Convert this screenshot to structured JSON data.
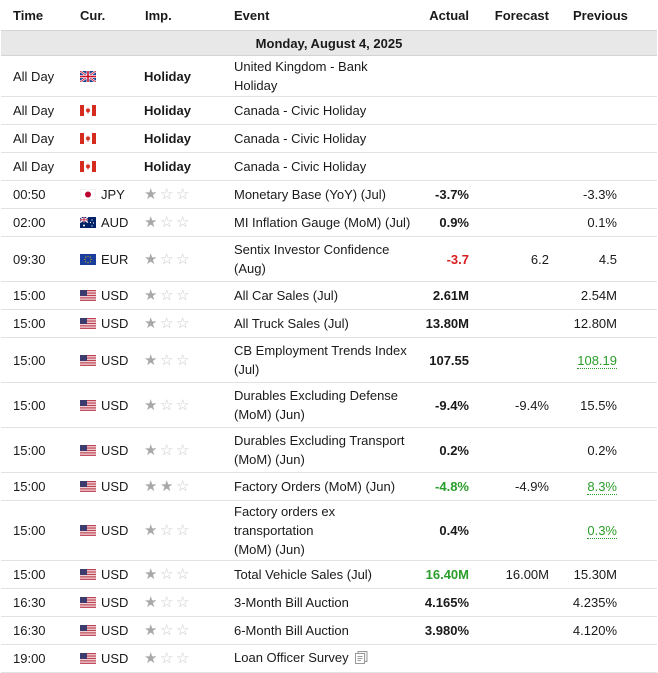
{
  "headers": {
    "time": "Time",
    "currency": "Cur.",
    "importance": "Imp.",
    "event": "Event",
    "actual": "Actual",
    "forecast": "Forecast",
    "previous": "Previous"
  },
  "date_label": "Monday, August 4, 2025",
  "colors": {
    "positive": "#2a9d2a",
    "negative": "#d91e1e",
    "star_full": "#a8a8a8",
    "star_empty": "#c9c9c9"
  },
  "rows": [
    {
      "time": "All Day",
      "flag": "uk-flag-icon",
      "currency": "",
      "holiday": "Holiday",
      "event": "United Kingdom - Bank Holiday",
      "actual": "",
      "forecast": "",
      "previous": ""
    },
    {
      "time": "All Day",
      "flag": "canada-flag-icon",
      "currency": "",
      "holiday": "Holiday",
      "event": "Canada - Civic Holiday",
      "actual": "",
      "forecast": "",
      "previous": ""
    },
    {
      "time": "All Day",
      "flag": "canada-flag-icon",
      "currency": "",
      "holiday": "Holiday",
      "event": "Canada - Civic Holiday",
      "actual": "",
      "forecast": "",
      "previous": ""
    },
    {
      "time": "All Day",
      "flag": "canada-flag-icon",
      "currency": "",
      "holiday": "Holiday",
      "event": "Canada - Civic Holiday",
      "actual": "",
      "forecast": "",
      "previous": ""
    },
    {
      "time": "00:50",
      "flag": "japan-flag-icon",
      "currency": "JPY",
      "stars": 1,
      "event": "Monetary Base (YoY) (Jul)",
      "actual": "-3.7%",
      "forecast": "",
      "previous": "-3.3%"
    },
    {
      "time": "02:00",
      "flag": "australia-flag-icon",
      "currency": "AUD",
      "stars": 1,
      "event": "MI Inflation Gauge (MoM) (Jul)",
      "actual": "0.9%",
      "forecast": "",
      "previous": "0.1%"
    },
    {
      "time": "09:30",
      "flag": "eu-flag-icon",
      "currency": "EUR",
      "stars": 1,
      "event_line1": "Sentix Investor Confidence",
      "event_line2": "(Aug)",
      "actual": "-3.7",
      "actual_color": "red",
      "forecast": "6.2",
      "previous": "4.5"
    },
    {
      "time": "15:00",
      "flag": "us-flag-icon",
      "currency": "USD",
      "stars": 1,
      "event": "All Car Sales (Jul)",
      "actual": "2.61M",
      "forecast": "",
      "previous": "2.54M"
    },
    {
      "time": "15:00",
      "flag": "us-flag-icon",
      "currency": "USD",
      "stars": 1,
      "event": "All Truck Sales (Jul)",
      "actual": "13.80M",
      "forecast": "",
      "previous": "12.80M"
    },
    {
      "time": "15:00",
      "flag": "us-flag-icon",
      "currency": "USD",
      "stars": 1,
      "event_line1": "CB Employment Trends Index",
      "event_line2": "(Jul)",
      "actual": "107.55",
      "forecast": "",
      "previous": "108.19",
      "previous_color": "green"
    },
    {
      "time": "15:00",
      "flag": "us-flag-icon",
      "currency": "USD",
      "stars": 1,
      "event_line1": "Durables Excluding Defense",
      "event_line2": "(MoM) (Jun)",
      "actual": "-9.4%",
      "forecast": "-9.4%",
      "previous": "15.5%"
    },
    {
      "time": "15:00",
      "flag": "us-flag-icon",
      "currency": "USD",
      "stars": 1,
      "event_line1": "Durables Excluding Transport",
      "event_line2": "(MoM) (Jun)",
      "actual": "0.2%",
      "forecast": "",
      "previous": "0.2%"
    },
    {
      "time": "15:00",
      "flag": "us-flag-icon",
      "currency": "USD",
      "stars": 2,
      "event": "Factory Orders (MoM) (Jun)",
      "actual": "-4.8%",
      "actual_color": "green",
      "forecast": "-4.9%",
      "previous": "8.3%",
      "previous_color": "green"
    },
    {
      "time": "15:00",
      "flag": "us-flag-icon",
      "currency": "USD",
      "stars": 1,
      "event_line1": "Factory orders ex transportation",
      "event_line2": "(MoM) (Jun)",
      "actual": "0.4%",
      "forecast": "",
      "previous": "0.3%",
      "previous_color": "green"
    },
    {
      "time": "15:00",
      "flag": "us-flag-icon",
      "currency": "USD",
      "stars": 1,
      "event": "Total Vehicle Sales (Jul)",
      "actual": "16.40M",
      "actual_color": "green",
      "forecast": "16.00M",
      "previous": "15.30M"
    },
    {
      "time": "16:30",
      "flag": "us-flag-icon",
      "currency": "USD",
      "stars": 1,
      "event": "3-Month Bill Auction",
      "actual": "4.165%",
      "forecast": "",
      "previous": "4.235%"
    },
    {
      "time": "16:30",
      "flag": "us-flag-icon",
      "currency": "USD",
      "stars": 1,
      "event": "6-Month Bill Auction",
      "actual": "3.980%",
      "forecast": "",
      "previous": "4.120%"
    },
    {
      "time": "19:00",
      "flag": "us-flag-icon",
      "currency": "USD",
      "stars": 1,
      "event": "Loan Officer Survey",
      "doc_icon": "document-icon",
      "actual": "",
      "forecast": "",
      "previous": ""
    }
  ]
}
